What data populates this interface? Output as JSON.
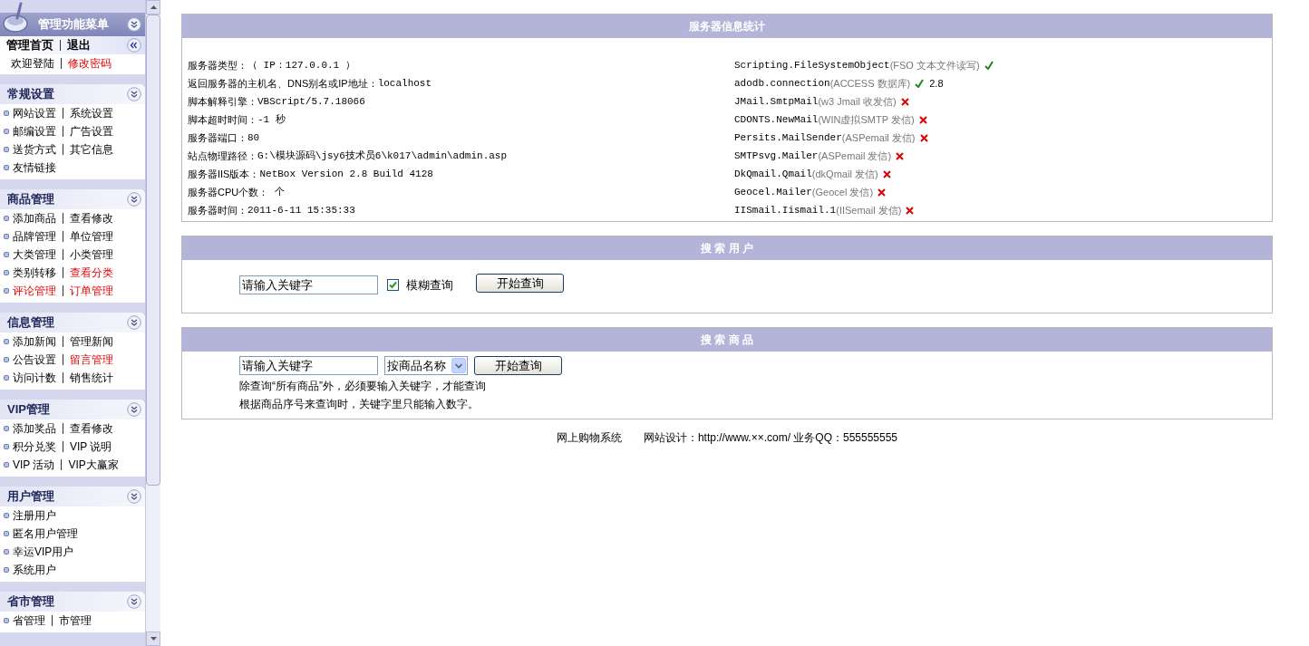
{
  "sidebar": {
    "title": "管理功能菜单",
    "top_rows": [
      [
        {
          "label": "管理首页",
          "bold": true,
          "highlighted": false
        },
        {
          "label": "退出",
          "bold": true,
          "highlighted": false
        }
      ],
      [
        {
          "label": "欢迎登陆",
          "bold": false,
          "highlighted": false
        },
        {
          "label": "修改密码",
          "bold": false,
          "highlighted": true
        }
      ]
    ],
    "sections": [
      {
        "title": "常规设置",
        "rows": [
          [
            {
              "label": "网站设置",
              "highlighted": false
            },
            {
              "label": "系统设置",
              "highlighted": false
            }
          ],
          [
            {
              "label": "邮编设置",
              "highlighted": false
            },
            {
              "label": "广告设置",
              "highlighted": false
            }
          ],
          [
            {
              "label": "送货方式",
              "highlighted": false
            },
            {
              "label": "其它信息",
              "highlighted": false
            }
          ],
          [
            {
              "label": "友情链接",
              "highlighted": false
            }
          ]
        ]
      },
      {
        "title": "商品管理",
        "rows": [
          [
            {
              "label": "添加商品",
              "highlighted": false
            },
            {
              "label": "查看修改",
              "highlighted": false
            }
          ],
          [
            {
              "label": "品牌管理",
              "highlighted": false
            },
            {
              "label": "单位管理",
              "highlighted": false
            }
          ],
          [
            {
              "label": "大类管理",
              "highlighted": false
            },
            {
              "label": "小类管理",
              "highlighted": false
            }
          ],
          [
            {
              "label": "类别转移",
              "highlighted": false
            },
            {
              "label": "查看分类",
              "highlighted": true
            }
          ],
          [
            {
              "label": "评论管理",
              "highlighted": true
            },
            {
              "label": "订单管理",
              "highlighted": true
            }
          ]
        ]
      },
      {
        "title": "信息管理",
        "rows": [
          [
            {
              "label": "添加新闻",
              "highlighted": false
            },
            {
              "label": "管理新闻",
              "highlighted": false
            }
          ],
          [
            {
              "label": "公告设置",
              "highlighted": false
            },
            {
              "label": "留言管理",
              "highlighted": true
            }
          ],
          [
            {
              "label": "访问计数",
              "highlighted": false
            },
            {
              "label": "销售统计",
              "highlighted": false
            }
          ]
        ]
      },
      {
        "title": "VIP管理",
        "rows": [
          [
            {
              "label": "添加奖品",
              "highlighted": false
            },
            {
              "label": "查看修改",
              "highlighted": false
            }
          ],
          [
            {
              "label": "积分兑奖",
              "highlighted": false
            },
            {
              "label": "VIP 说明",
              "highlighted": false
            }
          ],
          [
            {
              "label": "VIP 活动",
              "highlighted": false
            },
            {
              "label": "VIP大赢家",
              "highlighted": false
            }
          ]
        ]
      },
      {
        "title": "用户管理",
        "rows": [
          [
            {
              "label": "注册用户",
              "highlighted": false
            }
          ],
          [
            {
              "label": "匿名用户管理",
              "highlighted": false
            }
          ],
          [
            {
              "label": "幸运VIP用户",
              "highlighted": false
            }
          ],
          [
            {
              "label": "系统用户",
              "highlighted": false
            }
          ]
        ]
      },
      {
        "title": "省市管理",
        "rows": [
          [
            {
              "label": "省管理",
              "highlighted": false
            },
            {
              "label": "市管理",
              "highlighted": false
            }
          ]
        ]
      }
    ]
  },
  "server_info": {
    "title": "服务器信息统计",
    "items": [
      {
        "label": "服务器类型：",
        "value": "（ IP：127.0.0.1 ）"
      },
      {
        "label": "返回服务器的主机名、DNS别名或IP地址：",
        "value": "localhost"
      },
      {
        "label": "脚本解释引擎：",
        "value": "VBScript/5.7.18066"
      },
      {
        "label": "脚本超时时间：",
        "value": "-1 秒"
      },
      {
        "label": "服务器端口：",
        "value": "80"
      },
      {
        "label": "站点物理路径：",
        "value": "G:\\模块源码\\jsy6技术员6\\k017\\admin\\admin.asp"
      },
      {
        "label": "服务器IIS版本：",
        "value": "NetBox Version 2.8 Build 4128"
      },
      {
        "label": "服务器CPU个数：",
        "value": " 个"
      },
      {
        "label": "服务器时间：",
        "value": "2011-6-11 15:35:33"
      }
    ],
    "components": [
      {
        "name": "Scripting.FileSystemObject",
        "description": "(FSO 文本文件读写)",
        "supported": true
      },
      {
        "name": "adodb.connection",
        "description": "(ACCESS 数据库)",
        "supported": true,
        "version": "2.8"
      },
      {
        "name": "JMail.SmtpMail",
        "description": "(w3 Jmail 收发信)",
        "supported": false
      },
      {
        "name": "CDONTS.NewMail",
        "description": "(WIN虚拟SMTP 发信)",
        "supported": false
      },
      {
        "name": "Persits.MailSender",
        "description": "(ASPemail 发信)",
        "supported": false
      },
      {
        "name": "SMTPsvg.Mailer",
        "description": "(ASPemail 发信)",
        "supported": false
      },
      {
        "name": "DkQmail.Qmail",
        "description": "(dkQmail 发信)",
        "supported": false
      },
      {
        "name": "Geocel.Mailer",
        "description": "(Geocel 发信)",
        "supported": false
      },
      {
        "name": "IISmail.Iismail.1",
        "description": "(IISemail 发信)",
        "supported": false
      }
    ]
  },
  "search_user": {
    "title": "搜 索 用 户",
    "keyword": "请输入关键字",
    "fuzzy": {
      "label": "模糊查询",
      "checked": true
    },
    "button": "开始查询"
  },
  "search_goods": {
    "title": "搜 索 商 品",
    "keyword": "请输入关键字",
    "mode": "按商品名称",
    "button": "开始查询",
    "notes": [
      "除查询“所有商品”外，必须要输入关键字，才能查询",
      "根据商品序号来查询时，关键字里只能输入数字。"
    ]
  },
  "footer": {
    "system": "网上购物系统",
    "design": "网站设计：http://www.××.com/ 业务QQ：555555555"
  }
}
